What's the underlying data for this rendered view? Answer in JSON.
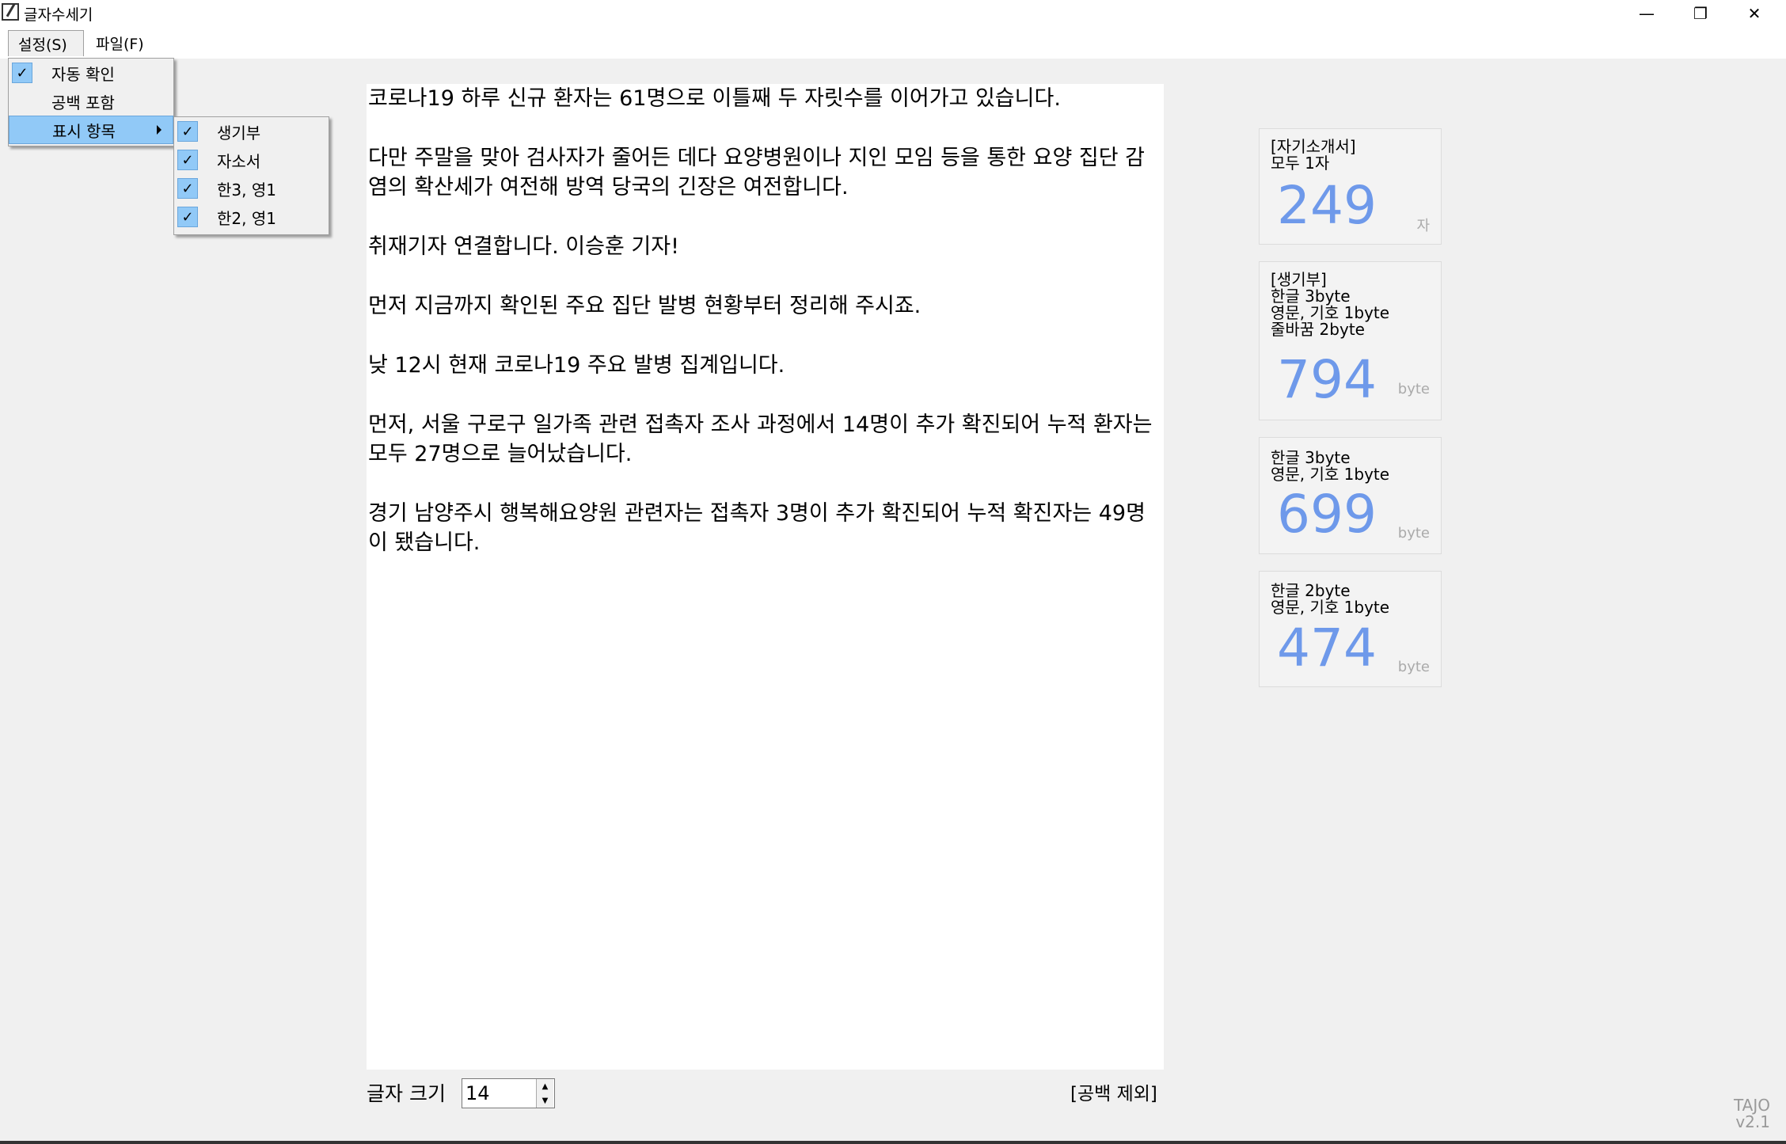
{
  "window": {
    "title": "글자수세기",
    "minimize": "—",
    "restore": "❐",
    "close": "✕"
  },
  "menubar": {
    "settings": "설정(S)",
    "file": "파일(F)"
  },
  "settings_menu": {
    "items": [
      {
        "label": "자동 확인",
        "checked": true
      },
      {
        "label": "공백 포함",
        "checked": false
      },
      {
        "label": "표시 항목",
        "submenu": true
      }
    ]
  },
  "display_submenu": {
    "items": [
      {
        "label": "생기부",
        "checked": true
      },
      {
        "label": "자소서",
        "checked": true
      },
      {
        "label": "한3, 영1",
        "checked": true
      },
      {
        "label": "한2, 영1",
        "checked": true
      }
    ]
  },
  "editor": {
    "paragraphs": [
      "코로나19 하루 신규 환자는 61명으로 이틀째 두 자릿수를 이어가고 있습니다.",
      "다만 주말을 맞아 검사자가 줄어든 데다 요양병원이나 지인 모임 등을 통한 요양 집단 감염의 확산세가 여전해 방역 당국의 긴장은 여전합니다.",
      "취재기자 연결합니다. 이승훈 기자!",
      "먼저 지금까지 확인된 주요 집단 발병 현황부터 정리해 주시죠.",
      "낮 12시 현재 코로나19 주요 발병 집계입니다.",
      "먼저, 서울 구로구 일가족 관련 접촉자 조사 과정에서 14명이 추가 확진되어 누적 환자는 모두 27명으로 늘어났습니다.",
      "경기 남양주시 행복해요양원 관련자는 접촉자 3명이 추가 확진되어 누적 확진자는 49명이 됐습니다."
    ]
  },
  "cards": [
    {
      "label": "[자기소개서]\n모두 1자",
      "value": "249",
      "unit": "자"
    },
    {
      "label": "[생기부]\n한글 3byte\n영문, 기호 1byte\n줄바꿈 2byte",
      "value": "794",
      "unit": "byte"
    },
    {
      "label": "한글 3byte\n영문, 기호 1byte",
      "value": "699",
      "unit": "byte"
    },
    {
      "label": "한글 2byte\n영문, 기호 1byte",
      "value": "474",
      "unit": "byte"
    }
  ],
  "footer": {
    "font_size_label": "글자 크기",
    "font_size_value": "14",
    "spacing_note": "[공백 제외]",
    "brand": "TAJO\nv2.1"
  },
  "colors": {
    "accent": "#6e99ea",
    "menu_highlight": "#91c9f7"
  }
}
